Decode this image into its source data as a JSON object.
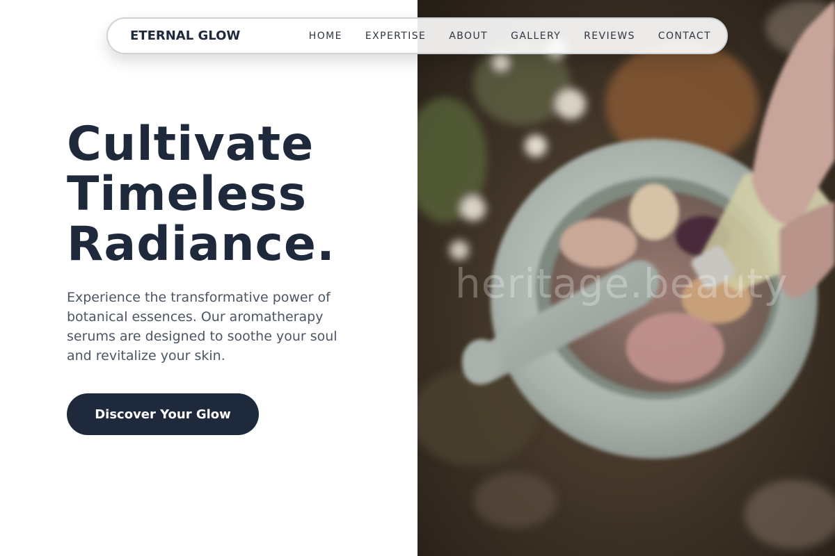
{
  "nav": {
    "brand": "ETERNAL GLOW",
    "items": [
      {
        "label": "HOME"
      },
      {
        "label": "EXPERTISE"
      },
      {
        "label": "ABOUT"
      },
      {
        "label": "GALLERY"
      },
      {
        "label": "REVIEWS"
      },
      {
        "label": "CONTACT"
      }
    ]
  },
  "hero": {
    "headline_lines": [
      "Cultivate",
      "Timeless",
      "Radiance."
    ],
    "lede": "Experience the transformative power of botanical essences. Our aromatherapy serums are designed to soothe your soul and revitalize your skin.",
    "cta_label": "Discover Your Glow",
    "image_watermark": "heritage.beauty"
  },
  "colors": {
    "primary": "#1e293b",
    "body_text": "#4b5563",
    "background": "#ffffff"
  }
}
